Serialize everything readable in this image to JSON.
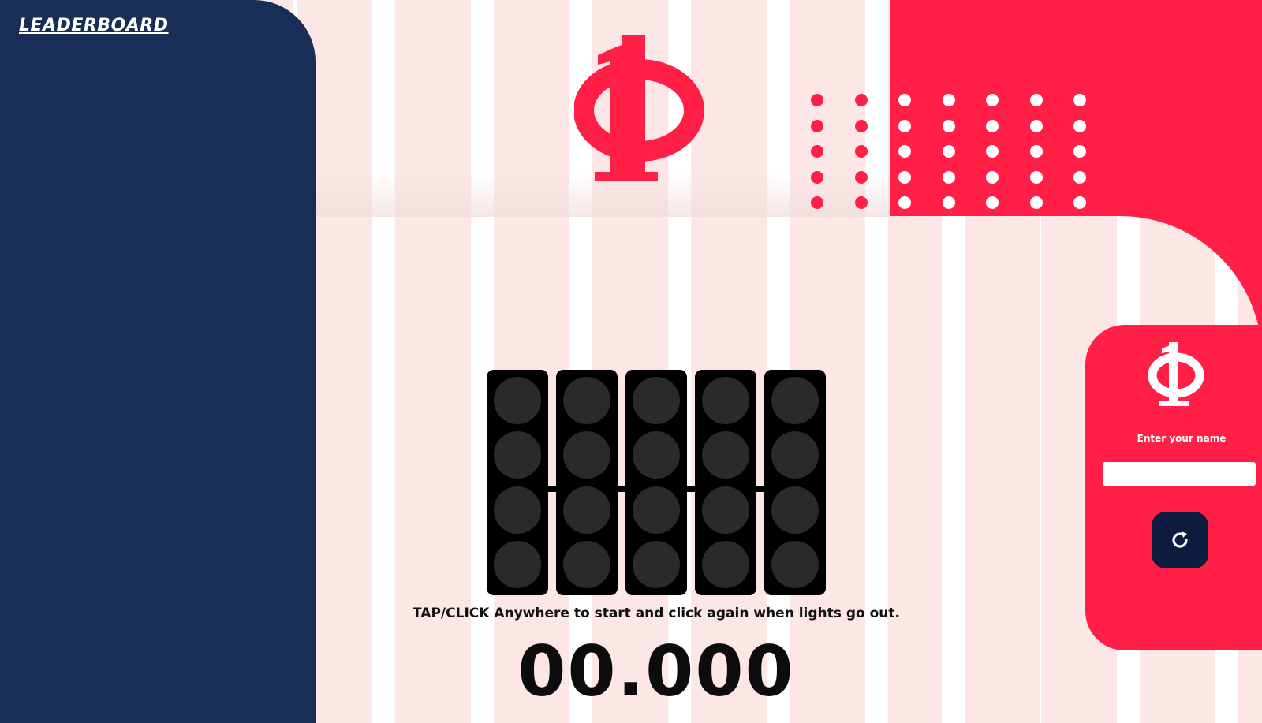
{
  "header": {
    "leaderboard_label": "LEADERBOARD"
  },
  "game": {
    "instructions": "TAP/CLICK Anywhere to start and click again when lights go out.",
    "timer": "00.000"
  },
  "name_card": {
    "label": "Enter your name",
    "input_value": "",
    "input_placeholder": ""
  },
  "icons": {
    "logo": "phi-1-logo",
    "reset": "reset-icon"
  },
  "colors": {
    "navy": "#182e56",
    "red": "#ff1f47",
    "pink": "#fde6e6",
    "dark_button": "#0d1c3e"
  }
}
